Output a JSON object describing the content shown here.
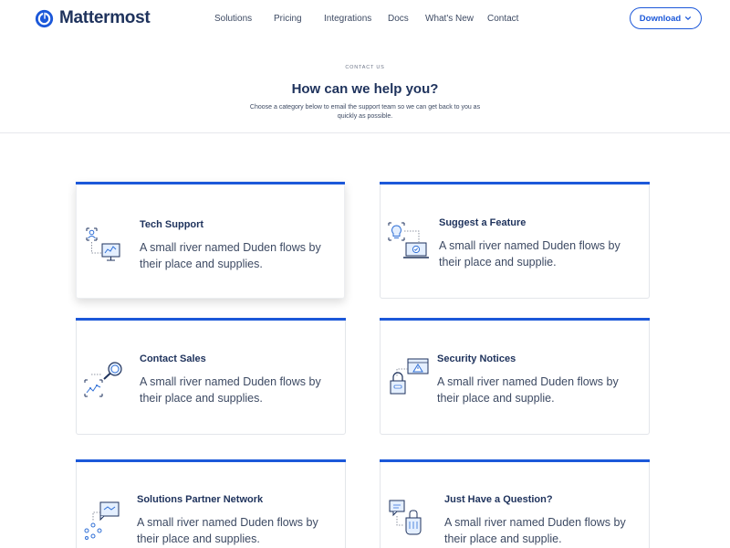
{
  "brand": {
    "name": "Mattermost"
  },
  "nav": {
    "links": [
      "Solutions",
      "Pricing",
      "Integrations",
      "Docs",
      "What's New",
      "Contact"
    ],
    "download_label": "Download"
  },
  "hero": {
    "eyebrow": "CONTACT US",
    "title": "How can we help you?",
    "subtitle": "Choose a category below to email the support team so we can get back to you as quickly as possible."
  },
  "cards": [
    {
      "title": "Tech Support",
      "text": "A small river named Duden flows by their place and supplies.",
      "icon": "support-monitor-icon"
    },
    {
      "title": "Suggest a Feature",
      "text": "A small river named Duden flows by their place and supplie.",
      "icon": "lightbulb-laptop-icon"
    },
    {
      "title": "Contact Sales",
      "text": "A small river named Duden flows by their place and supplies.",
      "icon": "magnifier-chart-icon"
    },
    {
      "title": "Security Notices",
      "text": "A small river named Duden flows by their place and supplie.",
      "icon": "lock-warning-icon"
    },
    {
      "title": "Solutions Partner Network",
      "text": "A small river named Duden flows by their place and supplies.",
      "icon": "handshake-network-icon"
    },
    {
      "title": "Just Have a Question?",
      "text": "A small river named Duden flows by their place and supplie.",
      "icon": "chat-hand-icon"
    }
  ],
  "colors": {
    "accent": "#1c58d9",
    "navy": "#1e325c",
    "body_text": "#3d4a63"
  }
}
